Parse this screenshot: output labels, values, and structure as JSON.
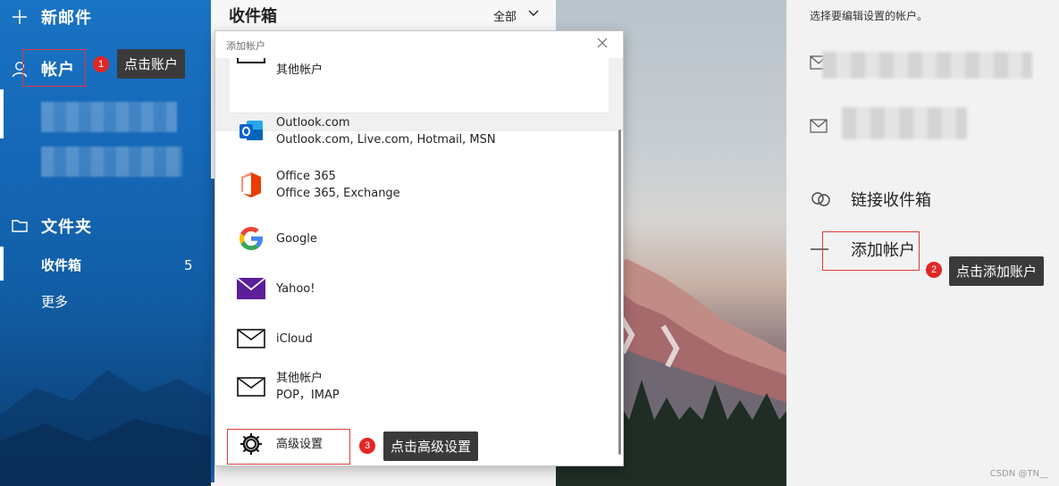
{
  "sidebar": {
    "new_mail": "新邮件",
    "accounts": "帐户",
    "folders": "文件夹",
    "inbox": "收件箱",
    "inbox_count": "5",
    "more": "更多"
  },
  "mail_list": {
    "title": "收件箱",
    "filter": "全部"
  },
  "settings": {
    "hint": "选择要编辑设置的帐户。",
    "link_inbox": "链接收件箱",
    "add_account": "添加帐户"
  },
  "dialog": {
    "title": "添加帐户",
    "top_item": "其他帐户",
    "providers": [
      {
        "name": "Outlook.com",
        "desc": "Outlook.com, Live.com, Hotmail, MSN",
        "icon": "outlook-icon"
      },
      {
        "name": "Office 365",
        "desc": "Office 365, Exchange",
        "icon": "office365-icon"
      },
      {
        "name": "Google",
        "desc": "",
        "icon": "google-icon"
      },
      {
        "name": "Yahoo!",
        "desc": "",
        "icon": "yahoo-mail-icon"
      },
      {
        "name": "iCloud",
        "desc": "",
        "icon": "envelope-icon"
      },
      {
        "name": "其他帐户",
        "desc": "POP，IMAP",
        "icon": "envelope-icon"
      }
    ],
    "advanced": "高级设置"
  },
  "annotations": {
    "step1": "1",
    "step1_tip": "点击账户",
    "step2": "2",
    "step2_tip": "点击添加账户",
    "step3": "3",
    "step3_tip": "点击高级设置"
  },
  "watermark": "CSDN @TN__",
  "colors": {
    "accent": "#1466b5",
    "annotation_red": "#e32626",
    "tooltip_bg": "#3a3a3a",
    "yahoo_purple": "#5c1e9a",
    "outlook_blue": "#0a64c8"
  }
}
